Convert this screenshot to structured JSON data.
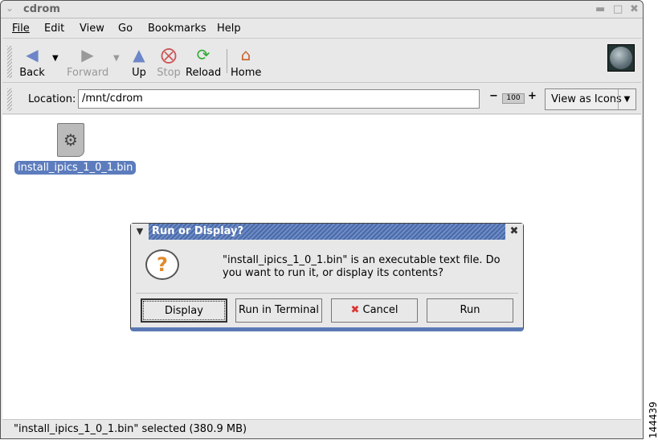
{
  "window": {
    "title": "cdrom"
  },
  "menu": [
    "File",
    "Edit",
    "View",
    "Go",
    "Bookmarks",
    "Help"
  ],
  "toolbar": {
    "back": "Back",
    "forward": "Forward",
    "up": "Up",
    "stop": "Stop",
    "reload": "Reload",
    "home": "Home"
  },
  "location": {
    "label": "Location:",
    "value": "/mnt/cdrom",
    "zoom": "100",
    "view_as": "View as Icons"
  },
  "files": [
    {
      "name": "install_ipics_1_0_1.bin"
    }
  ],
  "status": "\"install_ipics_1_0_1.bin\" selected (380.9 MB)",
  "dialog": {
    "title": "Run or Display?",
    "message": "\"install_ipics_1_0_1.bin\" is an executable text file. Do you want to run it, or display its contents?",
    "buttons": {
      "display": "Display",
      "terminal": "Run in Terminal",
      "cancel": "Cancel",
      "run": "Run"
    }
  },
  "figure_id": "144439"
}
